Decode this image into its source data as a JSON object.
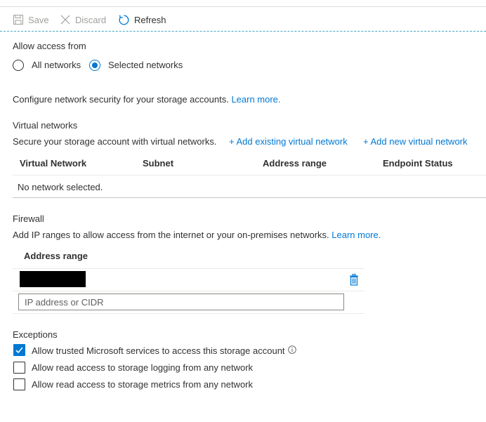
{
  "toolbar": {
    "save_label": "Save",
    "discard_label": "Discard",
    "refresh_label": "Refresh"
  },
  "access": {
    "heading": "Allow access from",
    "options": [
      {
        "label": "All networks",
        "selected": false
      },
      {
        "label": "Selected networks",
        "selected": true
      }
    ]
  },
  "intro": {
    "text": "Configure network security for your storage accounts.",
    "learn_more": "Learn more."
  },
  "virtual_networks": {
    "heading": "Virtual networks",
    "description": "Secure your storage account with virtual networks.",
    "add_existing": "+ Add existing virtual network",
    "add_new": "+ Add new virtual network",
    "columns": [
      "Virtual Network",
      "Subnet",
      "Address range",
      "Endpoint Status"
    ],
    "empty_text": "No network selected."
  },
  "firewall": {
    "heading": "Firewall",
    "description": "Add IP ranges to allow access from the internet or your on-premises networks.",
    "learn_more": "Learn more.",
    "column": "Address range",
    "input_placeholder": "IP address or CIDR"
  },
  "exceptions": {
    "heading": "Exceptions",
    "items": [
      {
        "label": "Allow trusted Microsoft services to access this storage account",
        "checked": true
      },
      {
        "label": "Allow read access to storage logging from any network",
        "checked": false
      },
      {
        "label": "Allow read access to storage metrics from any network",
        "checked": false
      }
    ]
  },
  "colors": {
    "accent": "#0078d4",
    "disabled": "#a19f9d",
    "text": "#323130"
  }
}
